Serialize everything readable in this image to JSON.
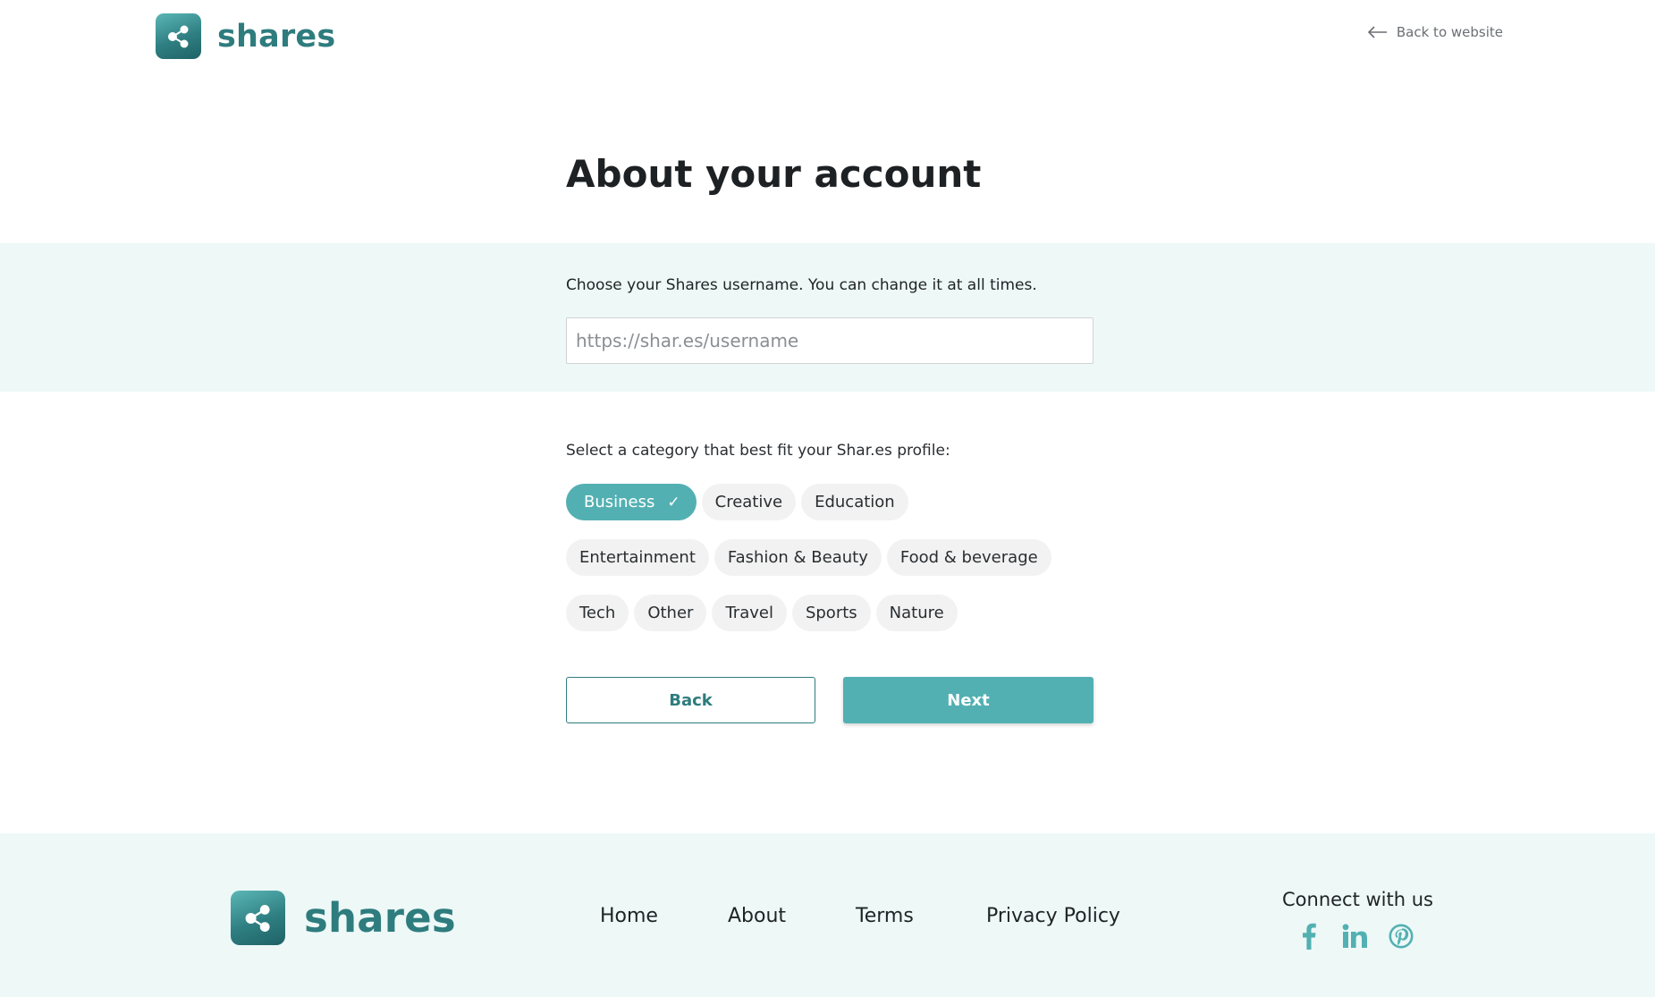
{
  "header": {
    "brand": "shares",
    "back_link": "Back to website"
  },
  "main": {
    "title": "About your account",
    "username": {
      "label": "Choose your Shares username. You can change it at all times.",
      "placeholder": "https://shar.es/username",
      "value": ""
    },
    "category": {
      "label": "Select a category that best fit your Shar.es profile:",
      "selected": "Business",
      "rows": [
        [
          "Business",
          "Creative",
          "Education"
        ],
        [
          "Entertainment",
          "Fashion & Beauty",
          "Food & beverage"
        ],
        [
          "Tech",
          "Other",
          "Travel",
          "Sports",
          "Nature"
        ]
      ]
    },
    "buttons": {
      "back": "Back",
      "next": "Next"
    }
  },
  "footer": {
    "brand": "shares",
    "nav": [
      "Home",
      "About",
      "Terms",
      "Privacy Policy"
    ],
    "connect_title": "Connect with us",
    "social": [
      "facebook-icon",
      "linkedin-icon",
      "pinterest-icon"
    ]
  },
  "colors": {
    "brand_dark": "#2e7c7e",
    "accent": "#53b0b2",
    "band_bg": "#edf8f7",
    "chip_bg": "#f2f2f2"
  }
}
